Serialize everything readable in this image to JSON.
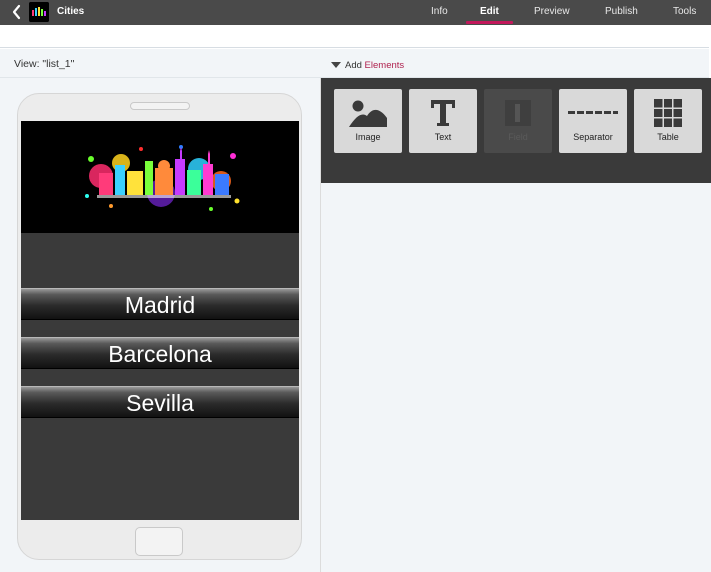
{
  "header": {
    "app_title": "Cities",
    "nav": [
      "Info",
      "Edit",
      "Preview",
      "Publish",
      "Tools"
    ],
    "active_tab": "Edit",
    "accent_color": "#c2185b"
  },
  "view_bar": {
    "view_label": "View: \"list_1\"",
    "add_prefix": "Add",
    "add_elements": "Elements"
  },
  "phone": {
    "list_items": [
      "Madrid",
      "Barcelona",
      "Sevilla"
    ]
  },
  "palette": {
    "tiles": [
      {
        "label": "Image",
        "icon": "image-icon",
        "enabled": true
      },
      {
        "label": "Text",
        "icon": "text-icon",
        "enabled": true
      },
      {
        "label": "Field",
        "icon": "field-icon",
        "enabled": false
      },
      {
        "label": "Separator",
        "icon": "separator-icon",
        "enabled": true
      },
      {
        "label": "Table",
        "icon": "table-icon",
        "enabled": true
      }
    ]
  }
}
